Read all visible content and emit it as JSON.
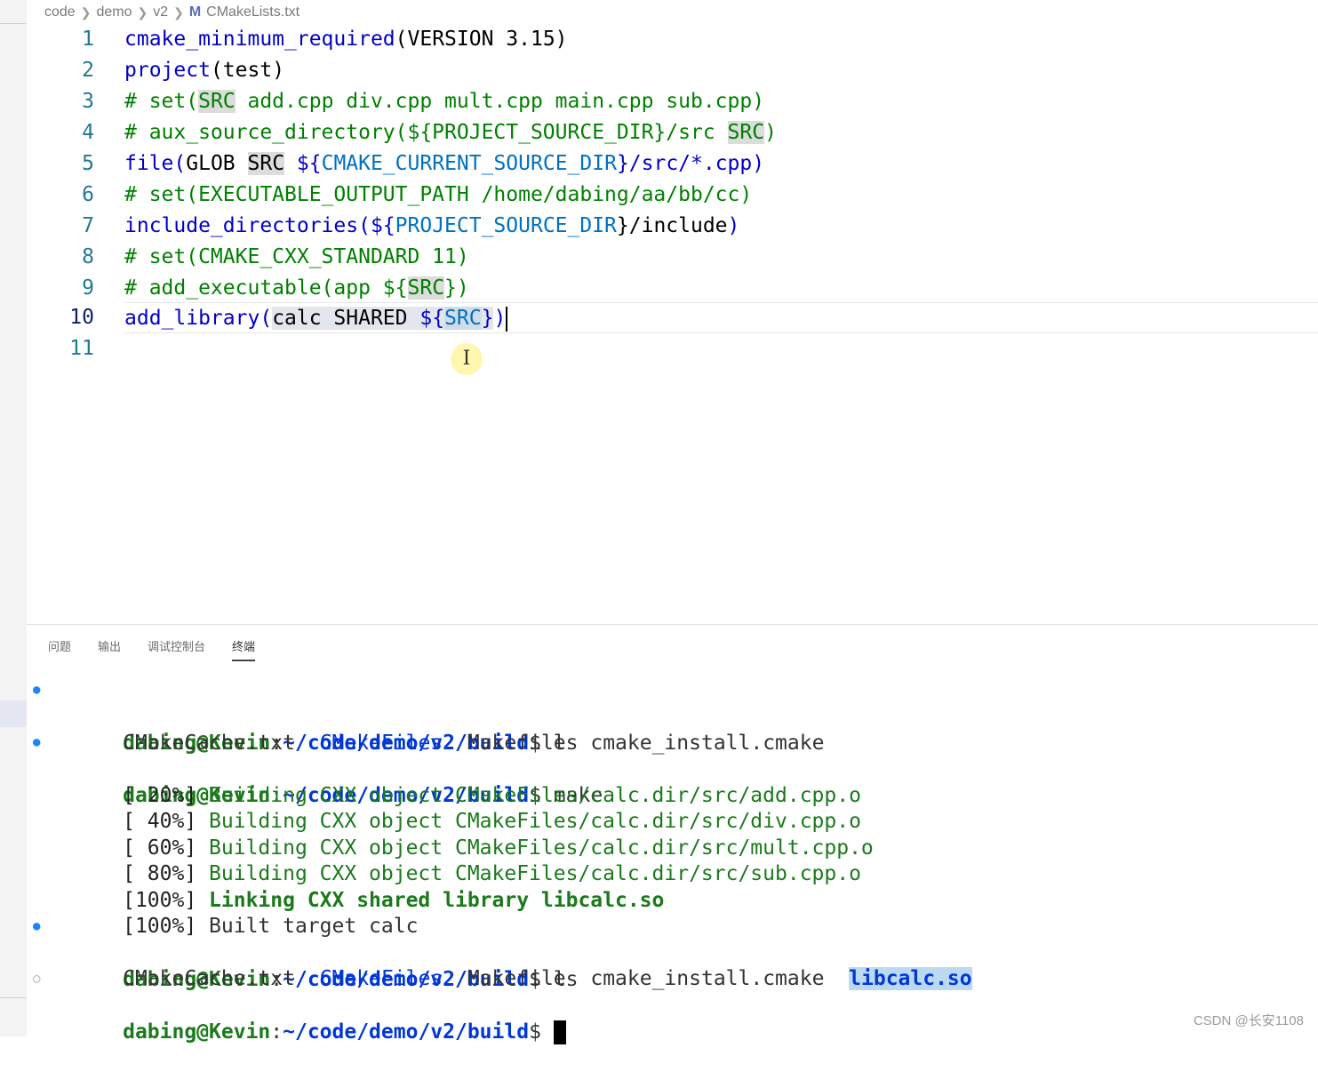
{
  "breadcrumb": {
    "p1": "code",
    "p2": "demo",
    "p3": "v2",
    "file_icon": "M",
    "file": "CMakeLists.txt"
  },
  "editor": {
    "l1": {
      "n": "1",
      "fn": "cmake_minimum_required",
      "a": "(",
      "b": "VERSION 3.15",
      "c": ")"
    },
    "l2": {
      "n": "2",
      "fn": "project",
      "a": "(",
      "b": "test",
      "c": ")"
    },
    "l3": {
      "n": "3",
      "a": "# set(",
      "h": "SRC",
      "b": " add.cpp div.cpp mult.cpp main.cpp sub.cpp)"
    },
    "l4": {
      "n": "4",
      "a": "# aux_source_directory(${PROJECT_SOURCE_DIR}/src ",
      "h": "SRC",
      "b": ")"
    },
    "l5": {
      "n": "5",
      "fn": "file",
      "a": "(",
      "b": "GLOB ",
      "h": "SRC",
      "c": " ${",
      "d": "CMAKE_CURRENT_SOURCE_DIR",
      "e": "}/src/*.cpp)"
    },
    "l6": {
      "n": "6",
      "a": "# set(EXECUTABLE_OUTPUT_PATH /home/dabing/aa/bb/cc)"
    },
    "l7": {
      "n": "7",
      "fn": "include_directories",
      "a": "(${",
      "d": "PROJECT_SOURCE_DIR",
      "b": "}/include",
      "c": ")"
    },
    "l8": {
      "n": "8",
      "a": "# set(CMAKE_CXX_STANDARD 11)"
    },
    "l9": {
      "n": "9",
      "a": "# add_executable(app ${",
      "h": "SRC",
      "b": "})"
    },
    "l10": {
      "n": "10",
      "fn": "add_library",
      "a": "(",
      "b": "calc SHARED ",
      "c": "${",
      "h": "SRC",
      "d": "}",
      "e": ")"
    },
    "l11": {
      "n": "11"
    },
    "cursor_glyph": "I"
  },
  "panel": {
    "tabs": [
      "问题",
      "输出",
      "调试控制台",
      "终端"
    ]
  },
  "terminal": {
    "user": "dabing@Kevin",
    "colon": ":",
    "path": "~/code/demo/v2/build",
    "dollar": "$",
    "cmd1": " ls",
    "ls1": {
      "f1": "CMakeCache.txt",
      "d1": "CMakeFiles",
      "f2": "Makefile",
      "f3": "cmake_install.cmake"
    },
    "cmd2": " make",
    "build": [
      {
        "pct": "[ 20%]",
        "msg": " Building CXX object CMakeFiles/calc.dir/src/add.cpp.o"
      },
      {
        "pct": "[ 40%]",
        "msg": " Building CXX object CMakeFiles/calc.dir/src/div.cpp.o"
      },
      {
        "pct": "[ 60%]",
        "msg": " Building CXX object CMakeFiles/calc.dir/src/mult.cpp.o"
      },
      {
        "pct": "[ 80%]",
        "msg": " Building CXX object CMakeFiles/calc.dir/src/sub.cpp.o"
      },
      {
        "pct": "[100%]",
        "msg": " Linking CXX shared library libcalc.so"
      },
      {
        "pct": "[100%]",
        "msg": " Built target calc"
      }
    ],
    "cmd3": " ls",
    "ls2": {
      "f1": "CMakeCache.txt",
      "d1": "CMakeFiles",
      "f2": "Makefile",
      "f3": "cmake_install.cmake",
      "f4": "libcalc.so"
    },
    "dot_filled": "●",
    "dot_hollow": "○"
  },
  "watermark": "CSDN @长安1108"
}
